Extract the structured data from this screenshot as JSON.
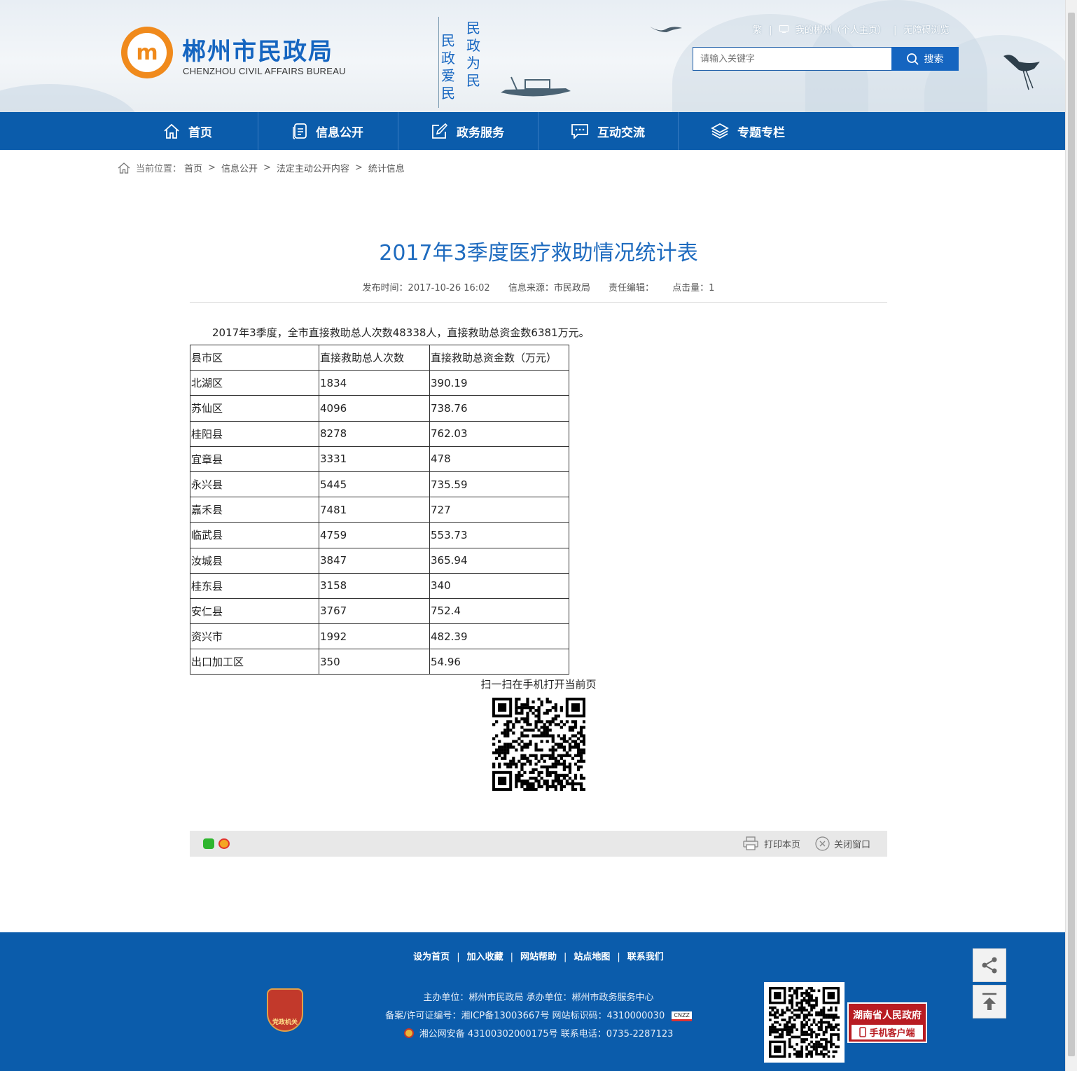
{
  "header": {
    "site_title": "郴州市民政局",
    "site_subtitle": "CHENZHOU CIVIL AFFAIRS BUREAU",
    "logo_letter": "m",
    "slogan_left": "民政爱民",
    "slogan_right": "民政为民",
    "top_links": {
      "traditional": "繁",
      "my_chenzhou": "我的郴州（个人主页）",
      "accessible": "无障碍浏览",
      "separator": "|"
    },
    "search": {
      "placeholder": "请输入关键字",
      "button": "搜索"
    }
  },
  "nav": {
    "items": [
      {
        "label": "首页",
        "icon": "home-icon"
      },
      {
        "label": "信息公开",
        "icon": "document-icon"
      },
      {
        "label": "政务服务",
        "icon": "edit-icon"
      },
      {
        "label": "互动交流",
        "icon": "chat-icon"
      },
      {
        "label": "专题专栏",
        "icon": "layers-icon"
      }
    ]
  },
  "breadcrumb": {
    "prefix": "当前位置：",
    "items": [
      "首页",
      "信息公开",
      "法定主动公开内容",
      "统计信息"
    ],
    "separator": ">"
  },
  "article": {
    "title": "2017年3季度医疗救助情况统计表",
    "meta": {
      "publish": "发布时间：2017-10-26 16:02",
      "source": "信息来源：市民政局",
      "editor": "责任编辑：",
      "hits": "点击量：1"
    },
    "lead": "2017年3季度，全市直接救助总人次数48338人，直接救助总资金数6381万元。",
    "table": {
      "headers": [
        "县市区",
        "直接救助总人次数",
        "直接救助总资金数（万元）"
      ],
      "rows": [
        [
          "北湖区",
          "1834",
          "390.19"
        ],
        [
          "苏仙区",
          "4096",
          "738.76"
        ],
        [
          "桂阳县",
          "8278",
          "762.03"
        ],
        [
          "宜章县",
          "3331",
          "478"
        ],
        [
          "永兴县",
          "5445",
          "735.59"
        ],
        [
          "嘉禾县",
          "7481",
          "727"
        ],
        [
          "临武县",
          "4759",
          "553.73"
        ],
        [
          "汝城县",
          "3847",
          "365.94"
        ],
        [
          "桂东县",
          "3158",
          "340"
        ],
        [
          "安仁县",
          "3767",
          "752.4"
        ],
        [
          "资兴市",
          "1992",
          "482.39"
        ],
        [
          "出口加工区",
          "350",
          "54.96"
        ]
      ]
    },
    "qr_label": "扫一扫在手机打开当前页"
  },
  "toolbar": {
    "print": "打印本页",
    "close": "关闭窗口"
  },
  "footer": {
    "links": [
      "设为首页",
      "加入收藏",
      "网站帮助",
      "站点地图",
      "联系我们"
    ],
    "link_separator": "|",
    "sponsor": "主办单位：郴州市民政局   承办单位：郴州市政务服务中心",
    "icp": "备案/许可证编号：湘ICP备13003667号    网站标识码：4310000030",
    "police": "湘公网安备 43100302000175号   联系电话：0735-2287123",
    "party_badge": "党政机关",
    "hunan_gov_top": "湖南省人民政府",
    "hunan_gov_bottom": "手机客户端",
    "cnzz_badge": "CNZZ"
  },
  "colors": {
    "primary_blue": "#0b5cab",
    "title_blue": "#1e6bbf",
    "logo_orange": "#f08a1c",
    "gov_red": "#b81c22"
  }
}
